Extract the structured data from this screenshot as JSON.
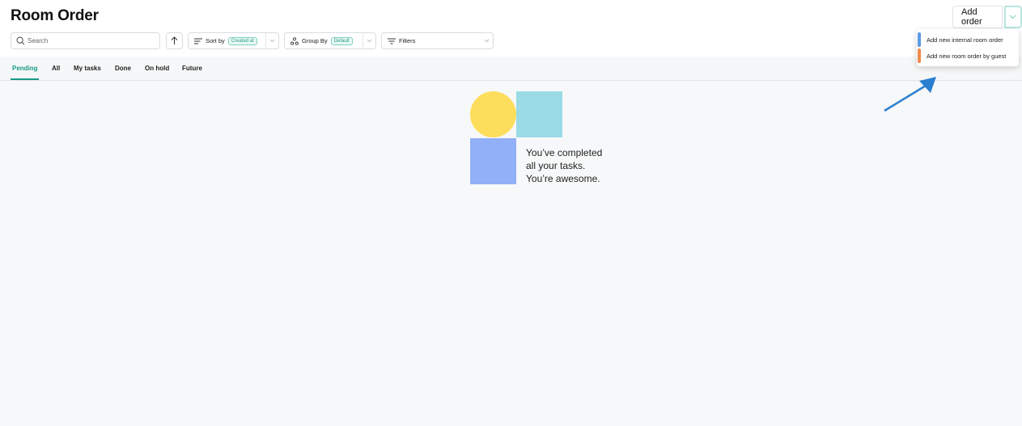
{
  "page": {
    "title": "Room Order"
  },
  "actions": {
    "add_order_label": "Add order"
  },
  "toolbar": {
    "search_placeholder": "Search",
    "sort": {
      "label": "Sort by",
      "value": "Created at"
    },
    "group": {
      "label": "Group By",
      "value": "Default"
    },
    "filters": {
      "label": "Filters"
    }
  },
  "tabs": [
    {
      "label": "Pending",
      "active": true
    },
    {
      "label": "All"
    },
    {
      "label": "My tasks"
    },
    {
      "label": "Done"
    },
    {
      "label": "On hold"
    },
    {
      "label": "Future"
    }
  ],
  "empty_state": {
    "line1": "You’ve completed",
    "line2": "all your tasks.",
    "line3": "You’re awesome."
  },
  "dropdown": {
    "items": [
      {
        "label": "Add new internal room order",
        "color": "#5b9be6"
      },
      {
        "label": "Add new room order by guest",
        "color": "#f08a4b"
      }
    ]
  },
  "colors": {
    "accent": "#1a9b86",
    "shape_yellow": "#fddd5c",
    "shape_teal": "#9adbe6",
    "shape_blue": "#92b0f7",
    "annotation_arrow": "#2a7fd0"
  },
  "icons": [
    "search-icon",
    "arrow-up-icon",
    "sort-lines-icon",
    "group-icon",
    "filter-icon",
    "chevron-down-icon",
    "annotation-arrow"
  ]
}
